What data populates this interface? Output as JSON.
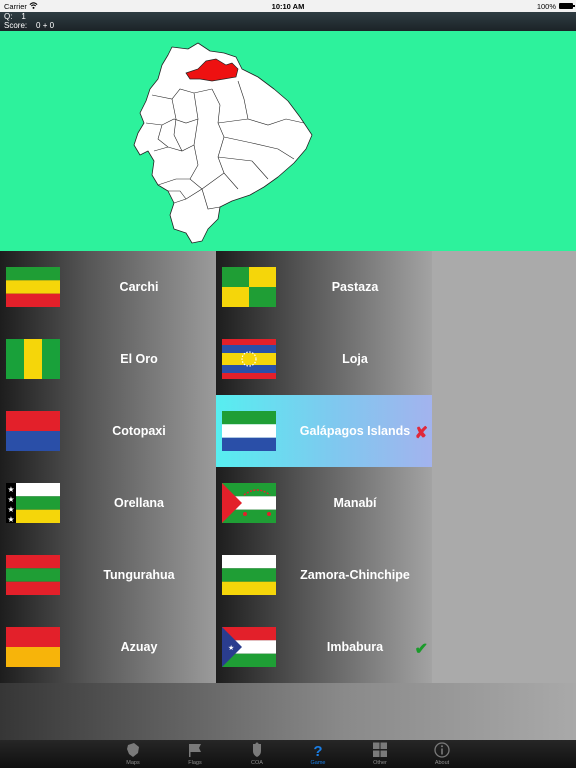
{
  "status": {
    "carrier": "Carrier",
    "wifi_icon": "wifi-icon",
    "time": "10:10 AM",
    "battery": "100%"
  },
  "info": {
    "q_label": "Q:",
    "q_value": "1",
    "score_label": "Score:",
    "score_value": "0 + 0"
  },
  "map": {
    "background": "#2df29c",
    "highlight_color": "#ee1111"
  },
  "tiles": [
    {
      "label": "Carchi",
      "flag": "flag-carchi",
      "mark": ""
    },
    {
      "label": "El Oro",
      "flag": "flag-el-oro",
      "mark": ""
    },
    {
      "label": "Cotopaxi",
      "flag": "flag-cotopaxi",
      "mark": ""
    },
    {
      "label": "Orellana",
      "flag": "flag-orellana",
      "mark": ""
    },
    {
      "label": "Tungurahua",
      "flag": "flag-tungurahua",
      "mark": ""
    },
    {
      "label": "Azuay",
      "flag": "flag-azuay",
      "mark": ""
    },
    {
      "label": "Pastaza",
      "flag": "flag-pastaza",
      "mark": ""
    },
    {
      "label": "Loja",
      "flag": "flag-loja",
      "mark": ""
    },
    {
      "label": "Galápagos Islands",
      "flag": "flag-galapagos",
      "mark": "✘"
    },
    {
      "label": "Manabí",
      "flag": "flag-manabi",
      "mark": ""
    },
    {
      "label": "Zamora-Chinchipe",
      "flag": "flag-zamora",
      "mark": ""
    },
    {
      "label": "Imbabura",
      "flag": "flag-imbabura",
      "mark": "✔"
    }
  ],
  "tabs": [
    {
      "label": "Maps",
      "icon": "map-icon"
    },
    {
      "label": "Flags",
      "icon": "flag-icon"
    },
    {
      "label": "COA",
      "icon": "coat-of-arms-icon"
    },
    {
      "label": "Game",
      "icon": "question-icon"
    },
    {
      "label": "Other",
      "icon": "grid-icon"
    },
    {
      "label": "About",
      "icon": "info-icon"
    }
  ],
  "colors": {
    "wrong_mark": "#e0283a",
    "correct_mark": "#1a9b2a",
    "active_tab": "#1a7ee5"
  }
}
